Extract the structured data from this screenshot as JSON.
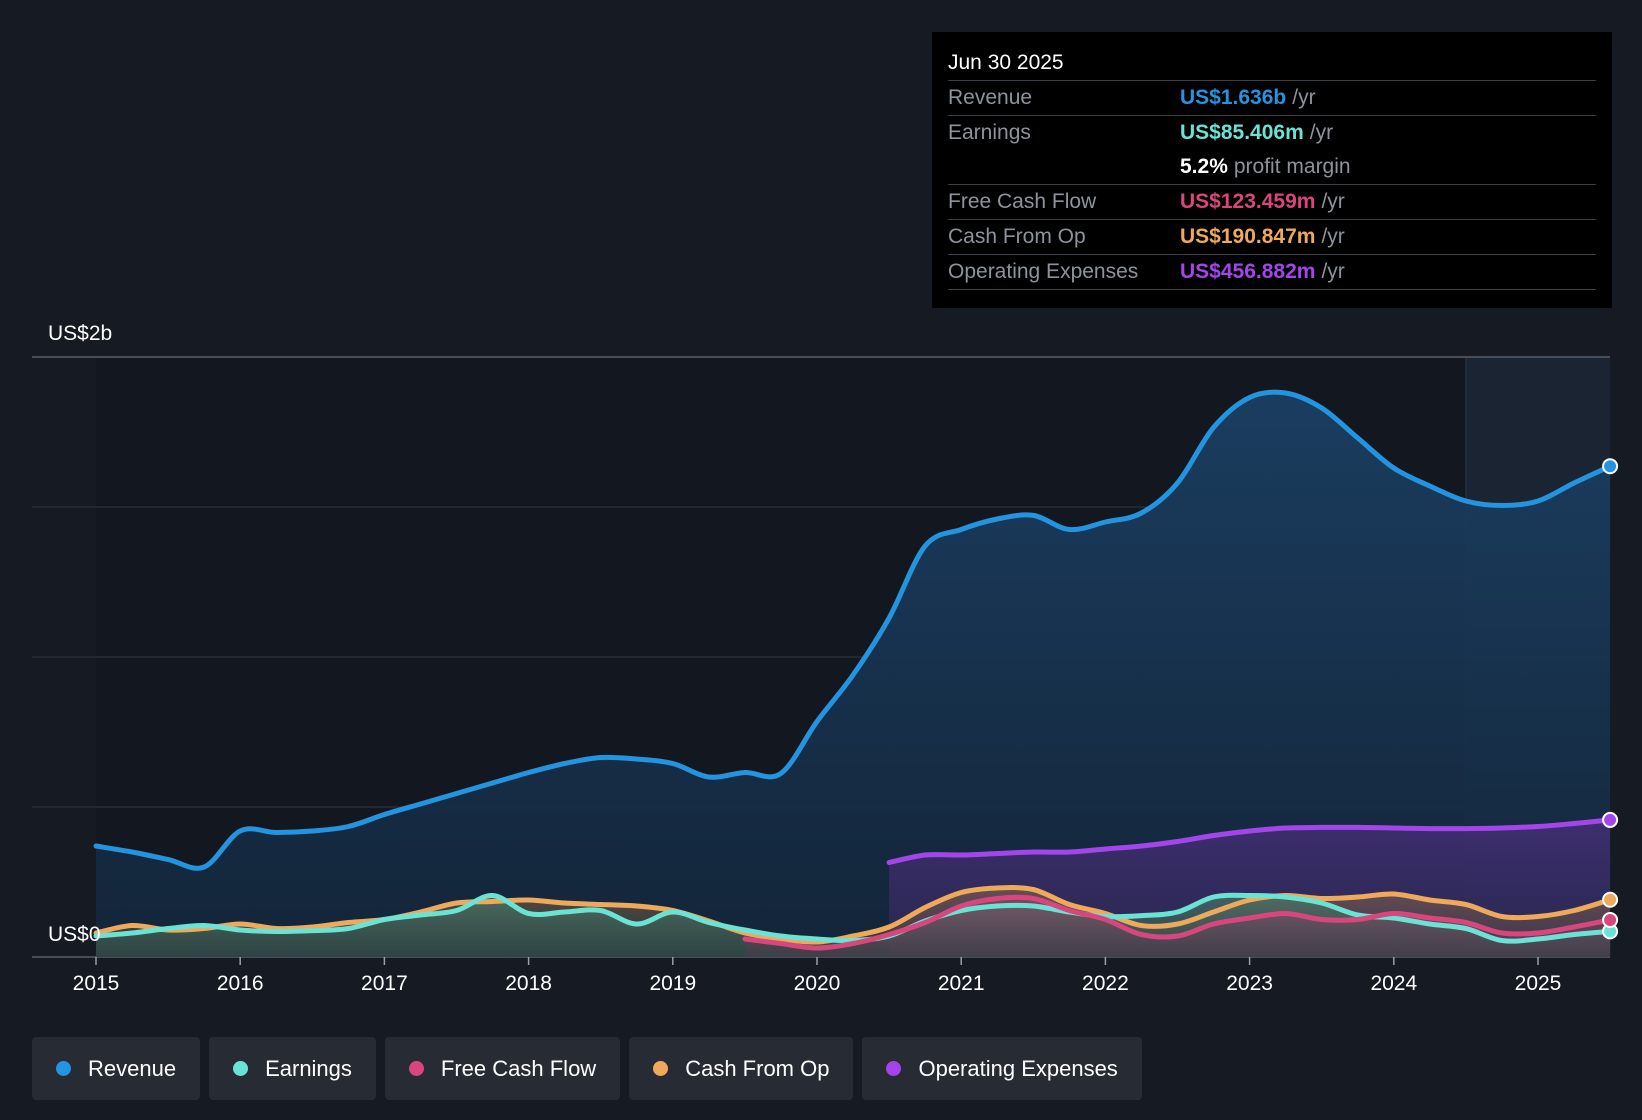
{
  "tooltip": {
    "date": "Jun 30 2025",
    "rows": [
      {
        "label": "Revenue",
        "value": "US$1.636b",
        "unit": "/yr",
        "color": "#2394df"
      },
      {
        "label": "Earnings",
        "value": "US$85.406m",
        "unit": "/yr",
        "color": "#6ae3d4"
      },
      {
        "label": "",
        "value": "5.2%",
        "unit": "profit margin",
        "color": "#ffffff"
      },
      {
        "label": "Free Cash Flow",
        "value": "US$123.459m",
        "unit": "/yr",
        "color": "#d9467d"
      },
      {
        "label": "Cash From Op",
        "value": "US$190.847m",
        "unit": "/yr",
        "color": "#eea95a"
      },
      {
        "label": "Operating Expenses",
        "value": "US$456.882m",
        "unit": "/yr",
        "color": "#a445ec"
      }
    ]
  },
  "chart_data": {
    "type": "area",
    "y_top_label": "US$2b",
    "y_bottom_label": "US$0",
    "ylim": [
      0,
      2000
    ],
    "xlim": [
      2015.0,
      2025.5
    ],
    "grid": true,
    "x_ticks": [
      2015,
      2016,
      2017,
      2018,
      2019,
      2020,
      2021,
      2022,
      2023,
      2024,
      2025
    ],
    "x_tick_labels": [
      "2015",
      "2016",
      "2017",
      "2018",
      "2019",
      "2020",
      "2021",
      "2022",
      "2023",
      "2024",
      "2025"
    ],
    "forecast_start": 2024.5,
    "series": [
      {
        "name": "Revenue",
        "color": "#2394df",
        "points": [
          [
            2015.0,
            370
          ],
          [
            2015.25,
            350
          ],
          [
            2015.5,
            325
          ],
          [
            2015.75,
            300
          ],
          [
            2016.0,
            420
          ],
          [
            2016.25,
            415
          ],
          [
            2016.5,
            420
          ],
          [
            2016.75,
            435
          ],
          [
            2017.0,
            475
          ],
          [
            2017.25,
            510
          ],
          [
            2017.5,
            545
          ],
          [
            2017.75,
            580
          ],
          [
            2018.0,
            615
          ],
          [
            2018.25,
            645
          ],
          [
            2018.5,
            665
          ],
          [
            2018.75,
            660
          ],
          [
            2019.0,
            645
          ],
          [
            2019.25,
            600
          ],
          [
            2019.5,
            615
          ],
          [
            2019.75,
            612
          ],
          [
            2020.0,
            785
          ],
          [
            2020.25,
            940
          ],
          [
            2020.5,
            1130
          ],
          [
            2020.75,
            1370
          ],
          [
            2021.0,
            1425
          ],
          [
            2021.25,
            1460
          ],
          [
            2021.5,
            1472
          ],
          [
            2021.75,
            1425
          ],
          [
            2022.0,
            1450
          ],
          [
            2022.25,
            1480
          ],
          [
            2022.5,
            1580
          ],
          [
            2022.75,
            1765
          ],
          [
            2023.0,
            1865
          ],
          [
            2023.25,
            1880
          ],
          [
            2023.5,
            1830
          ],
          [
            2023.75,
            1730
          ],
          [
            2024.0,
            1630
          ],
          [
            2024.25,
            1570
          ],
          [
            2024.5,
            1520
          ],
          [
            2024.75,
            1505
          ],
          [
            2025.0,
            1520
          ],
          [
            2025.25,
            1580
          ],
          [
            2025.5,
            1636
          ]
        ]
      },
      {
        "name": "Earnings",
        "color": "#6ae3d4",
        "points": [
          [
            2015.0,
            70
          ],
          [
            2015.25,
            80
          ],
          [
            2015.5,
            95
          ],
          [
            2015.75,
            105
          ],
          [
            2016.0,
            90
          ],
          [
            2016.25,
            85
          ],
          [
            2016.5,
            88
          ],
          [
            2016.75,
            95
          ],
          [
            2017.0,
            125
          ],
          [
            2017.25,
            140
          ],
          [
            2017.5,
            155
          ],
          [
            2017.75,
            205
          ],
          [
            2018.0,
            145
          ],
          [
            2018.25,
            150
          ],
          [
            2018.5,
            155
          ],
          [
            2018.75,
            110
          ],
          [
            2019.0,
            150
          ],
          [
            2019.25,
            115
          ],
          [
            2019.5,
            90
          ],
          [
            2019.75,
            70
          ],
          [
            2020.0,
            60
          ],
          [
            2020.25,
            55
          ],
          [
            2020.5,
            70
          ],
          [
            2020.75,
            120
          ],
          [
            2021.0,
            155
          ],
          [
            2021.25,
            170
          ],
          [
            2021.5,
            170
          ],
          [
            2021.75,
            150
          ],
          [
            2022.0,
            135
          ],
          [
            2022.25,
            138
          ],
          [
            2022.5,
            150
          ],
          [
            2022.75,
            200
          ],
          [
            2023.0,
            205
          ],
          [
            2023.25,
            200
          ],
          [
            2023.5,
            180
          ],
          [
            2023.75,
            140
          ],
          [
            2024.0,
            130
          ],
          [
            2024.25,
            110
          ],
          [
            2024.5,
            95
          ],
          [
            2024.75,
            55
          ],
          [
            2025.0,
            60
          ],
          [
            2025.25,
            75
          ],
          [
            2025.5,
            85.406
          ]
        ]
      },
      {
        "name": "Free Cash Flow",
        "color": "#d9467d",
        "points": [
          [
            2019.5,
            60
          ],
          [
            2019.75,
            45
          ],
          [
            2020.0,
            30
          ],
          [
            2020.25,
            45
          ],
          [
            2020.5,
            75
          ],
          [
            2020.75,
            115
          ],
          [
            2021.0,
            170
          ],
          [
            2021.25,
            195
          ],
          [
            2021.5,
            195
          ],
          [
            2021.75,
            155
          ],
          [
            2022.0,
            125
          ],
          [
            2022.25,
            75
          ],
          [
            2022.5,
            70
          ],
          [
            2022.75,
            110
          ],
          [
            2023.0,
            130
          ],
          [
            2023.25,
            145
          ],
          [
            2023.5,
            125
          ],
          [
            2023.75,
            125
          ],
          [
            2024.0,
            145
          ],
          [
            2024.25,
            130
          ],
          [
            2024.5,
            115
          ],
          [
            2024.75,
            80
          ],
          [
            2025.0,
            80
          ],
          [
            2025.25,
            100
          ],
          [
            2025.5,
            123.459
          ]
        ]
      },
      {
        "name": "Cash From Op",
        "color": "#eea95a",
        "points": [
          [
            2015.0,
            80
          ],
          [
            2015.25,
            105
          ],
          [
            2015.5,
            90
          ],
          [
            2015.75,
            95
          ],
          [
            2016.0,
            110
          ],
          [
            2016.25,
            95
          ],
          [
            2016.5,
            100
          ],
          [
            2016.75,
            115
          ],
          [
            2017.0,
            125
          ],
          [
            2017.25,
            150
          ],
          [
            2017.5,
            180
          ],
          [
            2017.75,
            185
          ],
          [
            2018.0,
            190
          ],
          [
            2018.25,
            180
          ],
          [
            2018.5,
            175
          ],
          [
            2018.75,
            170
          ],
          [
            2019.0,
            155
          ],
          [
            2019.25,
            120
          ],
          [
            2019.5,
            80
          ],
          [
            2019.75,
            60
          ],
          [
            2020.0,
            50
          ],
          [
            2020.25,
            70
          ],
          [
            2020.5,
            100
          ],
          [
            2020.75,
            165
          ],
          [
            2021.0,
            215
          ],
          [
            2021.25,
            230
          ],
          [
            2021.5,
            225
          ],
          [
            2021.75,
            175
          ],
          [
            2022.0,
            145
          ],
          [
            2022.25,
            105
          ],
          [
            2022.5,
            110
          ],
          [
            2022.75,
            150
          ],
          [
            2023.0,
            190
          ],
          [
            2023.25,
            205
          ],
          [
            2023.5,
            195
          ],
          [
            2023.75,
            200
          ],
          [
            2024.0,
            210
          ],
          [
            2024.25,
            190
          ],
          [
            2024.5,
            175
          ],
          [
            2024.75,
            135
          ],
          [
            2025.0,
            135
          ],
          [
            2025.25,
            155
          ],
          [
            2025.5,
            190.847
          ]
        ]
      },
      {
        "name": "Operating Expenses",
        "color": "#a445ec",
        "points": [
          [
            2020.5,
            315
          ],
          [
            2020.75,
            340
          ],
          [
            2021.0,
            340
          ],
          [
            2021.25,
            345
          ],
          [
            2021.5,
            350
          ],
          [
            2021.75,
            350
          ],
          [
            2022.0,
            360
          ],
          [
            2022.25,
            370
          ],
          [
            2022.5,
            385
          ],
          [
            2022.75,
            405
          ],
          [
            2023.0,
            420
          ],
          [
            2023.25,
            430
          ],
          [
            2023.5,
            432
          ],
          [
            2023.75,
            432
          ],
          [
            2024.0,
            430
          ],
          [
            2024.25,
            428
          ],
          [
            2024.5,
            428
          ],
          [
            2024.75,
            430
          ],
          [
            2025.0,
            435
          ],
          [
            2025.25,
            445
          ],
          [
            2025.5,
            456.882
          ]
        ]
      }
    ]
  },
  "legend": [
    {
      "label": "Revenue",
      "color": "#2394df"
    },
    {
      "label": "Earnings",
      "color": "#6ae3d4"
    },
    {
      "label": "Free Cash Flow",
      "color": "#d9467d"
    },
    {
      "label": "Cash From Op",
      "color": "#eea95a"
    },
    {
      "label": "Operating Expenses",
      "color": "#a445ec"
    }
  ]
}
